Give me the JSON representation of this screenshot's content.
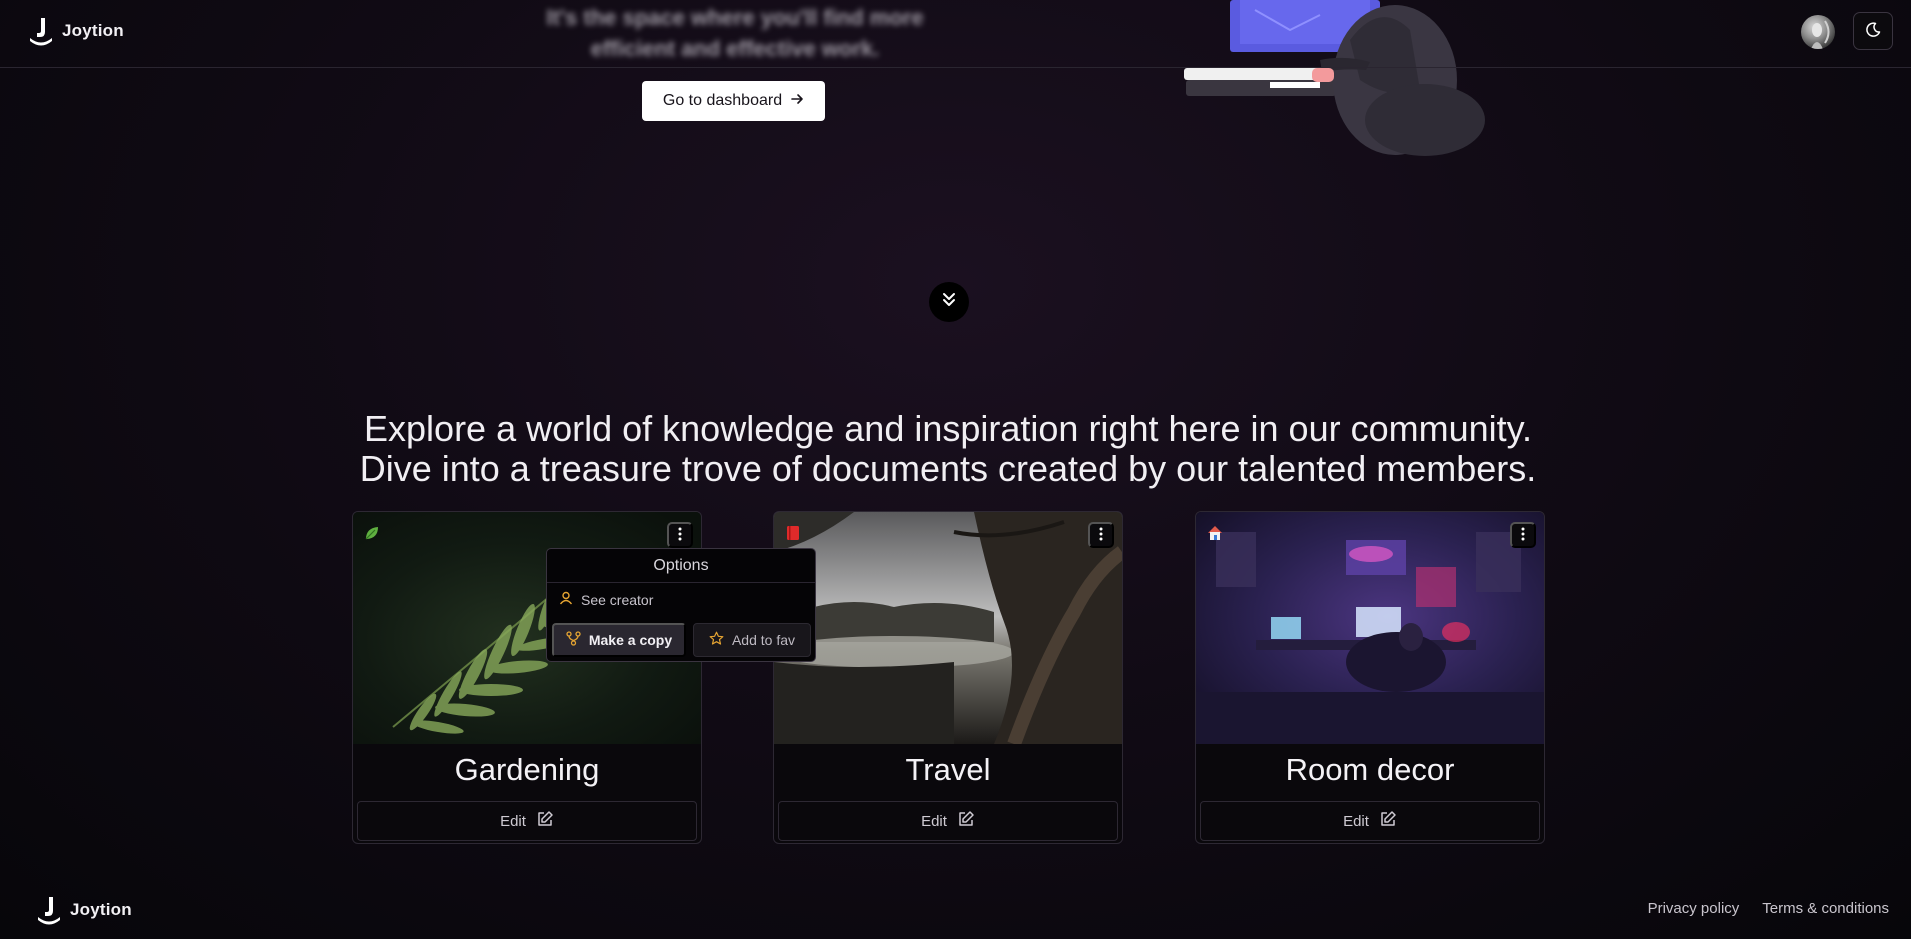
{
  "header": {
    "brand": "Joytion"
  },
  "hero": {
    "tagline": "It's the space where you'll find more efficient and effective work.",
    "cta_label": "Go to dashboard"
  },
  "intro": {
    "line1": "Explore a world of knowledge and inspiration right here in our community.",
    "line2": "Dive into a treasure trove of documents created by our talented members."
  },
  "cards": [
    {
      "title": "Gardening",
      "icon": "leaf-icon",
      "edit_label": "Edit"
    },
    {
      "title": "Travel",
      "icon": "book-icon",
      "edit_label": "Edit"
    },
    {
      "title": "Room decor",
      "icon": "house-icon",
      "edit_label": "Edit"
    }
  ],
  "options_menu": {
    "title": "Options",
    "see_creator": "See creator",
    "make_copy": "Make a copy",
    "add_fav": "Add to fav"
  },
  "footer": {
    "brand": "Joytion",
    "links": [
      "Privacy policy",
      "Terms & conditions"
    ]
  },
  "colors": {
    "background": "#0d0910",
    "accent_amber": "#e6a532",
    "border": "#2d2833"
  }
}
